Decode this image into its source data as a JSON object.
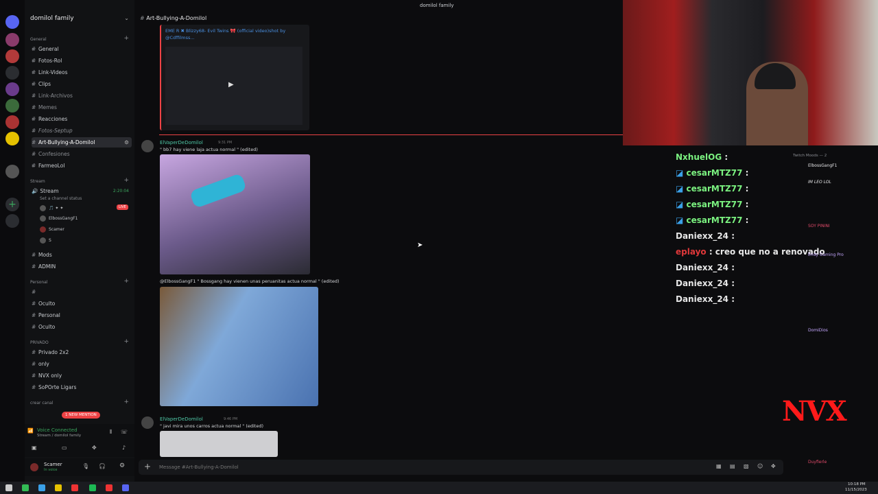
{
  "window": {
    "title": "domilol family"
  },
  "server": {
    "name": "domilol family"
  },
  "sidebar": {
    "categories": [
      {
        "label": "General"
      },
      {
        "label": "Stream"
      },
      {
        "label": "Personal"
      },
      {
        "label": "PRIVADO"
      },
      {
        "label": "crear canal"
      }
    ],
    "channels": [
      {
        "label": "General"
      },
      {
        "label": "Fotos-Rol"
      },
      {
        "label": "Link-Videos"
      },
      {
        "label": "Clips"
      },
      {
        "label": "Link-Archivos"
      },
      {
        "label": "Memes"
      },
      {
        "label": "Reacciones"
      },
      {
        "label": "Fotos-Septup"
      },
      {
        "label": "Art-Bullying-A-Domilol"
      },
      {
        "label": "Confesiones"
      },
      {
        "label": "FarmeoLol"
      }
    ],
    "stream": {
      "channel": "Stream",
      "timer": "2:20:04",
      "status": "Set a channel status",
      "live_badge": "LIVE",
      "users": [
        "ElbossGangF1",
        "Scamer"
      ]
    },
    "more_channels": [
      "Mods",
      "ADMIN",
      "Oculto",
      "Personal",
      "Oculto"
    ],
    "private_channels": [
      "Privado 2x2",
      "only",
      "NVX only",
      "SoPOrte Ligars"
    ],
    "mention_badge": "1 NEW MENTION",
    "voice": {
      "status": "Voice Connected",
      "detail": "Stream / domilol family"
    },
    "user": {
      "name": "Scamer",
      "status": "In voice"
    }
  },
  "chat": {
    "channel": "Art-Bullying-A-Domilol",
    "embed_title": "EME R ✖ Blizzy68- Evil Twins 🎀 (official video)shot by",
    "embed_sub": "@Cdffilmss...",
    "messages": [
      {
        "author": "ElVaperDeDomilol",
        "time": "9:31 PM",
        "text": "\" bb7 hay viene laja actua normal \" (edited)"
      },
      {
        "author": "",
        "time": "",
        "text": "@ElbossGangF1 \" Bossgang hay vienen unas peruanitas actua normal \" (edited)"
      },
      {
        "author": "ElVaperDeDomilol",
        "time": "9:46 PM",
        "text": "\" javi mira unos carros actua normal \" (edited)"
      }
    ],
    "input_placeholder": "Message #Art-Bullying-A-Domilol"
  },
  "overlay": {
    "chat_lines": [
      {
        "name": "NxhuelOG",
        "text": ""
      },
      {
        "name": "cesarMTZ77",
        "text": ""
      },
      {
        "name": "cesarMTZ77",
        "text": ""
      },
      {
        "name": "cesarMTZ77",
        "text": ""
      },
      {
        "name": "cesarMTZ77",
        "text": ""
      },
      {
        "name": "Daniexx_24",
        "text": ""
      },
      {
        "name": "eplayo",
        "text": "creo que no a renovado"
      },
      {
        "name": "Daniexx_24",
        "text": ""
      },
      {
        "name": "Daniexx_24",
        "text": ""
      },
      {
        "name": "Daniexx_24",
        "text": ""
      }
    ],
    "watchers_title": "Twitch Moods — 2",
    "watchers": [
      "ElbossGangF1",
      "IM LEO LOL",
      "SOY PININI",
      "Endy Gaming Pro",
      "DomiDios",
      "Duyfierle"
    ],
    "logo_text": "NVX"
  },
  "taskbar": {
    "time": "10:18 PM",
    "date": "11/15/2023"
  },
  "colors": {
    "accent": "#5865f2",
    "live": "#ed4245",
    "name_green": "#4fc7a6",
    "overlay_green": "#7bf280"
  }
}
